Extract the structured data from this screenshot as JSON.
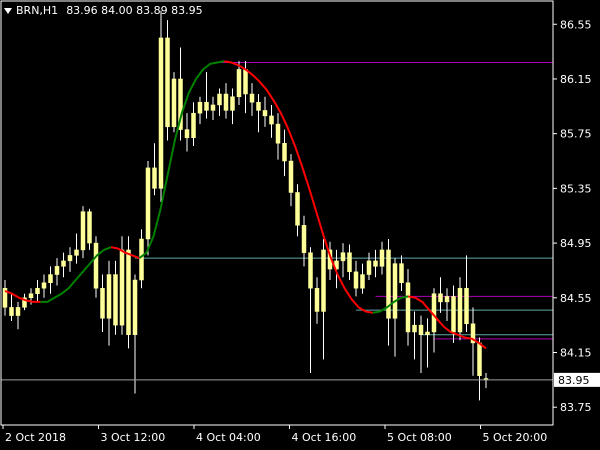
{
  "header": {
    "symbol": "BRN,H1",
    "ohlc": "83.96 84.00 83.89 83.95"
  },
  "colors": {
    "background": "#000000",
    "frame": "#ffffff",
    "candle_body": "#ffff99",
    "candle_wick": "#ffffff",
    "ma_up": "#008000",
    "ma_down": "#ff0000",
    "level_magenta": "#b000b0",
    "level_cyan": "#5fa8a8",
    "bid_line": "#a0a0a0"
  },
  "chart_data": {
    "type": "candlestick",
    "ylim": [
      83.62,
      86.72
    ],
    "y_ticks": [
      86.55,
      86.15,
      85.75,
      85.35,
      84.95,
      84.55,
      84.15,
      83.75
    ],
    "y_tick_labels": [
      "86.55",
      "86.15",
      "85.75",
      "85.35",
      "84.95",
      "84.55",
      "84.15",
      "83.75"
    ],
    "x_tick_labels": [
      "2 Oct 2018",
      "3 Oct 12:00",
      "4 Oct 04:00",
      "4 Oct 16:00",
      "5 Oct 08:00",
      "5 Oct 20:00"
    ],
    "current_price": "83.95",
    "candles": [
      [
        84.62,
        84.68,
        84.42,
        84.48
      ],
      [
        84.48,
        84.58,
        84.38,
        84.42
      ],
      [
        84.42,
        84.52,
        84.32,
        84.48
      ],
      [
        84.48,
        84.58,
        84.46,
        84.55
      ],
      [
        84.55,
        84.62,
        84.5,
        84.58
      ],
      [
        84.58,
        84.68,
        84.52,
        84.62
      ],
      [
        84.62,
        84.72,
        84.55,
        84.66
      ],
      [
        84.66,
        84.78,
        84.58,
        84.72
      ],
      [
        84.72,
        84.84,
        84.64,
        84.78
      ],
      [
        84.78,
        84.88,
        84.7,
        84.82
      ],
      [
        84.82,
        84.92,
        84.74,
        84.86
      ],
      [
        84.86,
        85.02,
        84.8,
        84.9
      ],
      [
        84.9,
        85.22,
        84.84,
        85.18
      ],
      [
        85.18,
        85.2,
        84.9,
        84.95
      ],
      [
        84.95,
        85.0,
        84.55,
        84.62
      ],
      [
        84.62,
        84.72,
        84.3,
        84.4
      ],
      [
        84.4,
        84.82,
        84.2,
        84.72
      ],
      [
        84.72,
        84.82,
        84.28,
        84.35
      ],
      [
        84.35,
        85.0,
        84.28,
        84.9
      ],
      [
        84.9,
        85.0,
        84.18,
        84.28
      ],
      [
        84.28,
        84.72,
        83.85,
        84.68
      ],
      [
        84.68,
        85.05,
        84.62,
        84.98
      ],
      [
        84.98,
        85.55,
        84.86,
        85.5
      ],
      [
        85.5,
        85.68,
        85.3,
        85.35
      ],
      [
        85.35,
        86.65,
        85.25,
        86.45
      ],
      [
        86.45,
        86.58,
        85.7,
        85.8
      ],
      [
        85.8,
        86.2,
        85.76,
        86.15
      ],
      [
        86.15,
        86.38,
        85.7,
        85.78
      ],
      [
        85.78,
        85.9,
        85.62,
        85.72
      ],
      [
        85.72,
        85.98,
        85.66,
        85.9
      ],
      [
        85.9,
        86.02,
        85.82,
        85.98
      ],
      [
        85.98,
        86.2,
        85.86,
        85.92
      ],
      [
        85.92,
        86.02,
        85.85,
        85.96
      ],
      [
        85.96,
        86.08,
        85.88,
        86.04
      ],
      [
        86.04,
        86.12,
        85.86,
        85.92
      ],
      [
        85.92,
        86.08,
        85.82,
        86.02
      ],
      [
        86.02,
        86.28,
        85.96,
        86.22
      ],
      [
        86.22,
        86.28,
        85.9,
        86.04
      ],
      [
        86.04,
        86.12,
        85.88,
        85.98
      ],
      [
        85.98,
        86.04,
        85.76,
        85.92
      ],
      [
        85.92,
        86.02,
        85.8,
        85.88
      ],
      [
        85.88,
        85.96,
        85.72,
        85.82
      ],
      [
        85.82,
        85.9,
        85.56,
        85.68
      ],
      [
        85.68,
        85.78,
        85.44,
        85.55
      ],
      [
        85.55,
        85.6,
        85.22,
        85.32
      ],
      [
        85.32,
        85.38,
        85.0,
        85.08
      ],
      [
        85.08,
        85.15,
        84.78,
        84.88
      ],
      [
        84.88,
        84.92,
        84.0,
        84.62
      ],
      [
        84.62,
        84.7,
        84.36,
        84.45
      ],
      [
        84.45,
        84.98,
        84.1,
        84.9
      ],
      [
        84.9,
        84.96,
        84.68,
        84.76
      ],
      [
        84.76,
        84.9,
        84.62,
        84.82
      ],
      [
        84.82,
        84.95,
        84.7,
        84.88
      ],
      [
        84.88,
        84.94,
        84.68,
        84.74
      ],
      [
        84.74,
        84.82,
        84.56,
        84.62
      ],
      [
        84.62,
        84.8,
        84.58,
        84.72
      ],
      [
        84.72,
        84.88,
        84.68,
        84.82
      ],
      [
        84.82,
        84.9,
        84.7,
        84.78
      ],
      [
        84.78,
        84.96,
        84.72,
        84.9
      ],
      [
        84.9,
        84.98,
        84.2,
        84.4
      ],
      [
        84.4,
        84.84,
        84.12,
        84.8
      ],
      [
        84.8,
        84.86,
        84.6,
        84.66
      ],
      [
        84.66,
        84.76,
        84.2,
        84.3
      ],
      [
        84.3,
        84.45,
        84.1,
        84.35
      ],
      [
        84.35,
        84.42,
        84.0,
        84.28
      ],
      [
        84.28,
        84.4,
        84.04,
        84.3
      ],
      [
        84.3,
        84.62,
        84.15,
        84.58
      ],
      [
        84.58,
        84.7,
        84.44,
        84.52
      ],
      [
        84.52,
        84.62,
        84.38,
        84.56
      ],
      [
        84.56,
        84.64,
        84.22,
        84.3
      ],
      [
        84.3,
        84.7,
        84.24,
        84.62
      ],
      [
        84.62,
        84.86,
        84.3,
        84.36
      ],
      [
        84.36,
        84.48,
        83.98,
        84.22
      ],
      [
        84.22,
        84.26,
        83.8,
        83.98
      ],
      [
        83.96,
        84.0,
        83.89,
        83.95
      ]
    ],
    "ma_segments": [
      {
        "trend": "down",
        "points": [
          84.6,
          84.58,
          84.55,
          84.53,
          84.52,
          84.52
        ]
      },
      {
        "trend": "up",
        "points": [
          84.52,
          84.52,
          84.55,
          84.58,
          84.62,
          84.68,
          84.74,
          84.8,
          84.86,
          84.9,
          84.92
        ]
      },
      {
        "trend": "down",
        "points": [
          84.92,
          84.91,
          84.88,
          84.86,
          84.84
        ]
      },
      {
        "trend": "up",
        "points": [
          84.84,
          84.88,
          85.0,
          85.2,
          85.45,
          85.7,
          85.9,
          86.05,
          86.15,
          86.22,
          86.26,
          86.27,
          86.28
        ]
      },
      {
        "trend": "down",
        "points": [
          86.28,
          86.27,
          86.25,
          86.22,
          86.18,
          86.13,
          86.07,
          85.99,
          85.9,
          85.79,
          85.66,
          85.51,
          85.35,
          85.18,
          85.01,
          84.85,
          84.72,
          84.62,
          84.54,
          84.48,
          84.45,
          84.44
        ]
      },
      {
        "trend": "up",
        "points": [
          84.44,
          84.45,
          84.48,
          84.52,
          84.55,
          84.56
        ]
      },
      {
        "trend": "down",
        "points": [
          84.56,
          84.55,
          84.52,
          84.46,
          84.4,
          84.34,
          84.3,
          84.28,
          84.26,
          84.25,
          84.22,
          84.18
        ]
      }
    ],
    "levels": [
      {
        "price": 86.27,
        "from": 33,
        "color": "magenta"
      },
      {
        "price": 84.84,
        "from": 20,
        "color": "cyan"
      },
      {
        "price": 84.56,
        "from": 57,
        "color": "magenta"
      },
      {
        "price": 84.46,
        "from": 54,
        "color": "cyan"
      },
      {
        "price": 84.28,
        "from": 64,
        "color": "cyan"
      },
      {
        "price": 84.25,
        "from": 66,
        "color": "magenta"
      }
    ]
  }
}
